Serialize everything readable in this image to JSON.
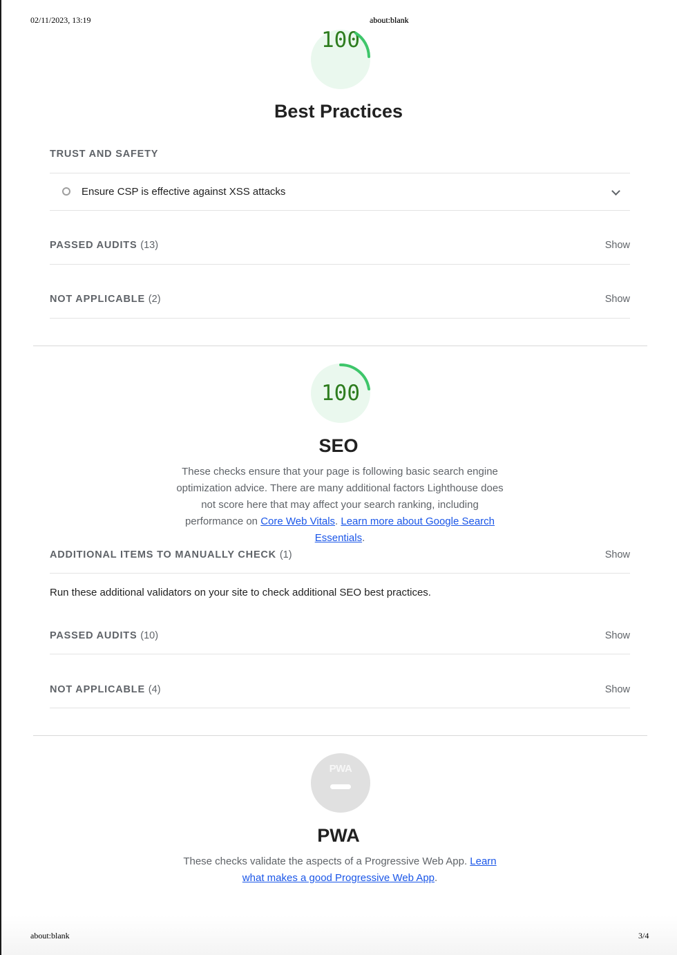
{
  "print_header": {
    "datetime": "02/11/2023, 13:19",
    "title": "about:blank"
  },
  "print_footer": {
    "url": "about:blank",
    "page": "3/4"
  },
  "best_practices": {
    "score": "100",
    "score_fraction": 1.0,
    "title": "Best Practices",
    "trust_group_title": "TRUST AND SAFETY",
    "audit_label": "Ensure CSP is effective against XSS attacks",
    "passed_title": "PASSED AUDITS",
    "passed_count": "(13)",
    "na_title": "NOT APPLICABLE",
    "na_count": "(2)",
    "show_label": "Show"
  },
  "seo": {
    "score": "100",
    "score_fraction": 1.0,
    "title": "SEO",
    "description_pre": "These checks ensure that your page is following basic search engine optimization advice. There are many additional factors Lighthouse does not score here that may affect your search ranking, including performance on ",
    "link_cwv": "Core Web Vitals",
    "description_mid": ". ",
    "link_search": "Learn more about Google Search Essentials",
    "description_post": ".",
    "manual_title": "ADDITIONAL ITEMS TO MANUALLY CHECK",
    "manual_count": "(1)",
    "manual_desc": "Run these additional validators on your site to check additional SEO best practices.",
    "passed_title": "PASSED AUDITS",
    "passed_count": "(10)",
    "na_title": "NOT APPLICABLE",
    "na_count": "(4)",
    "show_label": "Show"
  },
  "pwa": {
    "badge_label": "PWA",
    "title": "PWA",
    "description_pre": "These checks validate the aspects of a Progressive Web App. ",
    "link": "Learn what makes a good Progressive Web App",
    "description_post": "."
  },
  "colors": {
    "pass_green": "#0cce6b",
    "score_text": "#2e7d1f",
    "gauge_fill": "#eaf8ee",
    "link_blue": "#1a56e8"
  }
}
